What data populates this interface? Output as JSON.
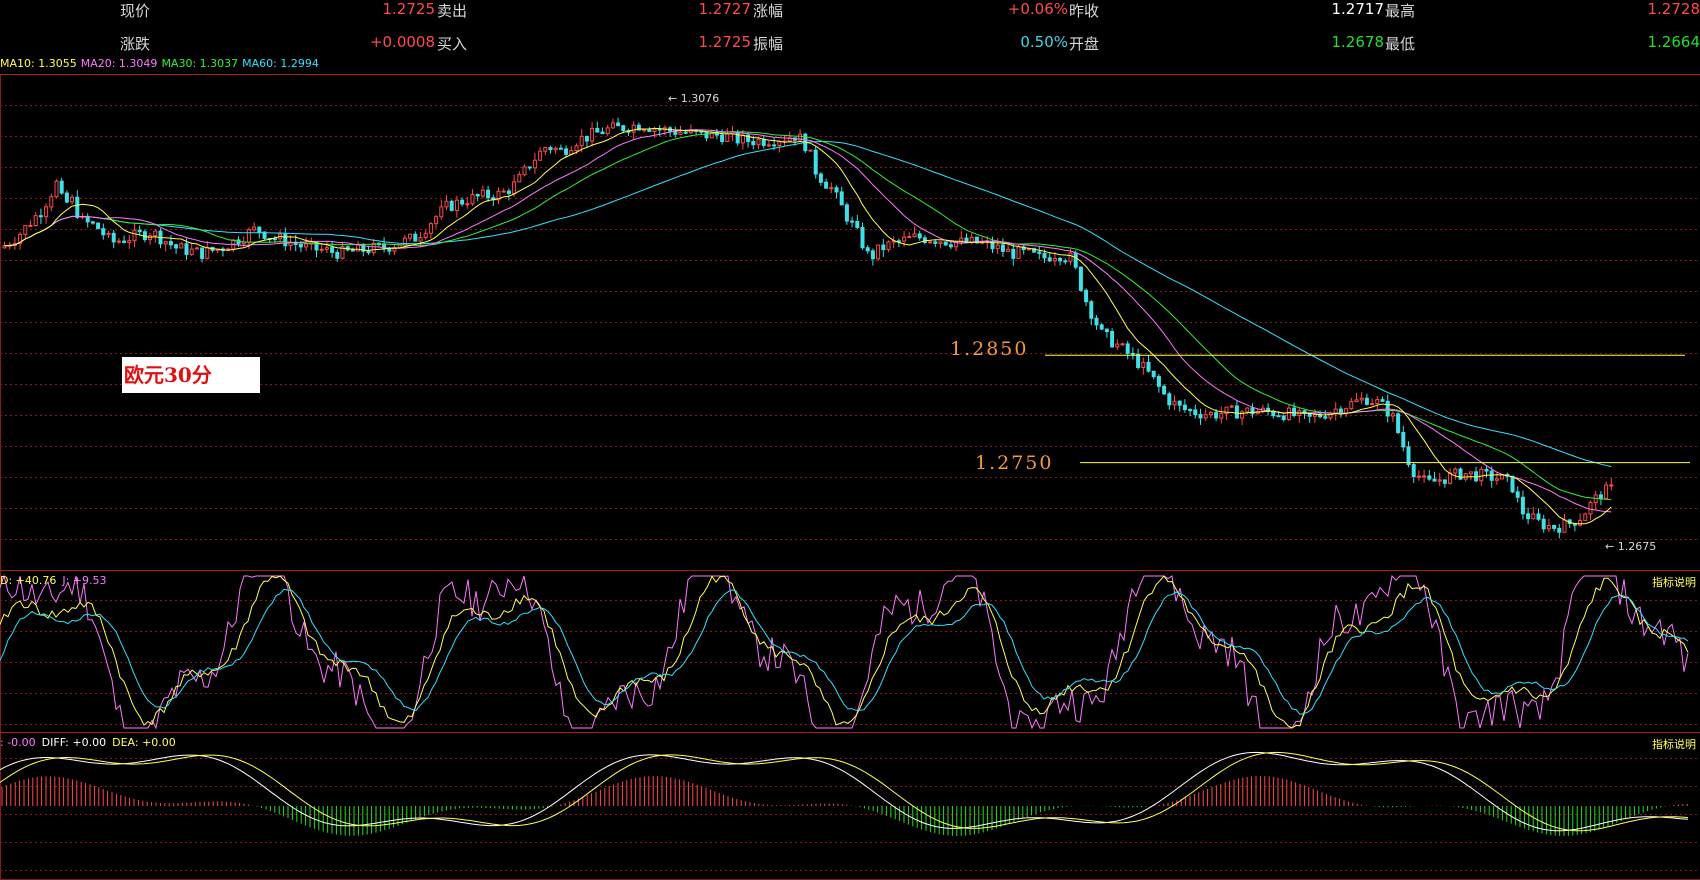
{
  "quote": {
    "rows": [
      [
        {
          "label": "现价",
          "value": "1.2725",
          "cls": "up"
        },
        {
          "label": "卖出",
          "value": "1.2727",
          "cls": "up"
        },
        {
          "label": "涨幅",
          "value": "+0.06%",
          "cls": "up"
        },
        {
          "label": "昨收",
          "value": "1.2717",
          "cls": "wh"
        },
        {
          "label": "最高",
          "value": "1.2728",
          "cls": "up"
        }
      ],
      [
        {
          "label": "涨跌",
          "value": "+0.0008",
          "cls": "up"
        },
        {
          "label": "买入",
          "value": "1.2725",
          "cls": "up"
        },
        {
          "label": "振幅",
          "value": "0.50%",
          "cls": "cy"
        },
        {
          "label": "开盘",
          "value": "1.2678",
          "cls": "gn"
        },
        {
          "label": "最低",
          "value": "1.2664",
          "cls": "gn"
        }
      ]
    ]
  },
  "ma": [
    {
      "text": "MA10: 1.3055",
      "color": "#ffff55"
    },
    {
      "text": "MA20: 1.3049",
      "color": "#ff77ff"
    },
    {
      "text": "MA30: 1.3037",
      "color": "#33ee33"
    },
    {
      "text": "MA60: 1.2994",
      "color": "#33e0ff"
    }
  ],
  "pair_label": "欧元30分",
  "levels": [
    {
      "label": "1.2850",
      "price": 1.285
    },
    {
      "label": "1.2750",
      "price": 1.275
    }
  ],
  "annotations": {
    "high": "1.3076",
    "low": "1.2675"
  },
  "kdj": {
    "title_parts": [
      {
        "text": "D: +40.76",
        "color": "#ffff55"
      },
      {
        "text": "J: +9.53",
        "color": "#ff77ff"
      }
    ],
    "button": "指标说明"
  },
  "macd": {
    "title_parts": [
      {
        "text": ": -0.00",
        "color": "#ff77ff"
      },
      {
        "text": "DIFF: +0.00",
        "color": "#ffffff"
      },
      {
        "text": "DEA: +0.00",
        "color": "#ffff55"
      }
    ],
    "button": "指标说明"
  },
  "colors": {
    "up": "#ff4a4a",
    "down": "#40e0e8",
    "grid": "#8a1818",
    "ma10": "#ffff55",
    "ma20": "#ff77ff",
    "ma30": "#33ee33",
    "ma60": "#33e0ff",
    "level": "#ffff55"
  },
  "chart_data": {
    "type": "candlestick",
    "ylim": [
      1.265,
      1.311
    ],
    "price_path": [
      [
        0,
        1.295
      ],
      [
        15,
        1.296
      ],
      [
        40,
        1.2985
      ],
      [
        55,
        1.301
      ],
      [
        62,
        1.299
      ],
      [
        70,
        1.2995
      ],
      [
        80,
        1.2975
      ],
      [
        95,
        1.297
      ],
      [
        110,
        1.2955
      ],
      [
        130,
        1.296
      ],
      [
        150,
        1.2965
      ],
      [
        175,
        1.295
      ],
      [
        200,
        1.2945
      ],
      [
        220,
        1.295
      ],
      [
        240,
        1.296
      ],
      [
        255,
        1.2968
      ],
      [
        270,
        1.296
      ],
      [
        290,
        1.2955
      ],
      [
        305,
        1.295
      ],
      [
        320,
        1.2948
      ],
      [
        340,
        1.2945
      ],
      [
        360,
        1.2948
      ],
      [
        380,
        1.295
      ],
      [
        400,
        1.2955
      ],
      [
        415,
        1.296
      ],
      [
        430,
        1.2975
      ],
      [
        445,
        1.2988
      ],
      [
        465,
        1.2995
      ],
      [
        480,
        1.2998
      ],
      [
        500,
        1.3
      ],
      [
        515,
        1.301
      ],
      [
        530,
        1.303
      ],
      [
        545,
        1.3045
      ],
      [
        560,
        1.304
      ],
      [
        575,
        1.305
      ],
      [
        590,
        1.3055
      ],
      [
        605,
        1.306
      ],
      [
        620,
        1.3062
      ],
      [
        640,
        1.3065
      ],
      [
        660,
        1.306
      ],
      [
        680,
        1.3058
      ],
      [
        700,
        1.3055
      ],
      [
        720,
        1.3055
      ],
      [
        740,
        1.305
      ],
      [
        760,
        1.305
      ],
      [
        780,
        1.3052
      ],
      [
        795,
        1.3055
      ],
      [
        805,
        1.3045
      ],
      [
        815,
        1.302
      ],
      [
        830,
        1.3005
      ],
      [
        845,
        1.298
      ],
      [
        858,
        1.296
      ],
      [
        868,
        1.294
      ],
      [
        880,
        1.295
      ],
      [
        895,
        1.2955
      ],
      [
        915,
        1.296
      ],
      [
        935,
        1.2958
      ],
      [
        955,
        1.2955
      ],
      [
        975,
        1.2955
      ],
      [
        995,
        1.295
      ],
      [
        1010,
        1.2945
      ],
      [
        1025,
        1.2945
      ],
      [
        1040,
        1.294
      ],
      [
        1055,
        1.2945
      ],
      [
        1070,
        1.294
      ],
      [
        1085,
        1.29
      ],
      [
        1100,
        1.287
      ],
      [
        1115,
        1.286
      ],
      [
        1135,
        1.2845
      ],
      [
        1150,
        1.283
      ],
      [
        1165,
        1.281
      ],
      [
        1180,
        1.28
      ],
      [
        1195,
        1.2797
      ],
      [
        1210,
        1.2795
      ],
      [
        1230,
        1.2797
      ],
      [
        1250,
        1.2798
      ],
      [
        1270,
        1.2797
      ],
      [
        1290,
        1.2795
      ],
      [
        1305,
        1.279
      ],
      [
        1320,
        1.2795
      ],
      [
        1335,
        1.28
      ],
      [
        1350,
        1.2805
      ],
      [
        1365,
        1.281
      ],
      [
        1378,
        1.2805
      ],
      [
        1390,
        1.2795
      ],
      [
        1400,
        1.277
      ],
      [
        1410,
        1.2745
      ],
      [
        1425,
        1.273
      ],
      [
        1440,
        1.2735
      ],
      [
        1460,
        1.274
      ],
      [
        1480,
        1.2738
      ],
      [
        1500,
        1.2735
      ],
      [
        1510,
        1.273
      ],
      [
        1520,
        1.2705
      ],
      [
        1535,
        1.2695
      ],
      [
        1550,
        1.269
      ],
      [
        1565,
        1.2692
      ],
      [
        1580,
        1.27
      ],
      [
        1590,
        1.2712
      ],
      [
        1600,
        1.2722
      ],
      [
        1610,
        1.2725
      ]
    ]
  }
}
